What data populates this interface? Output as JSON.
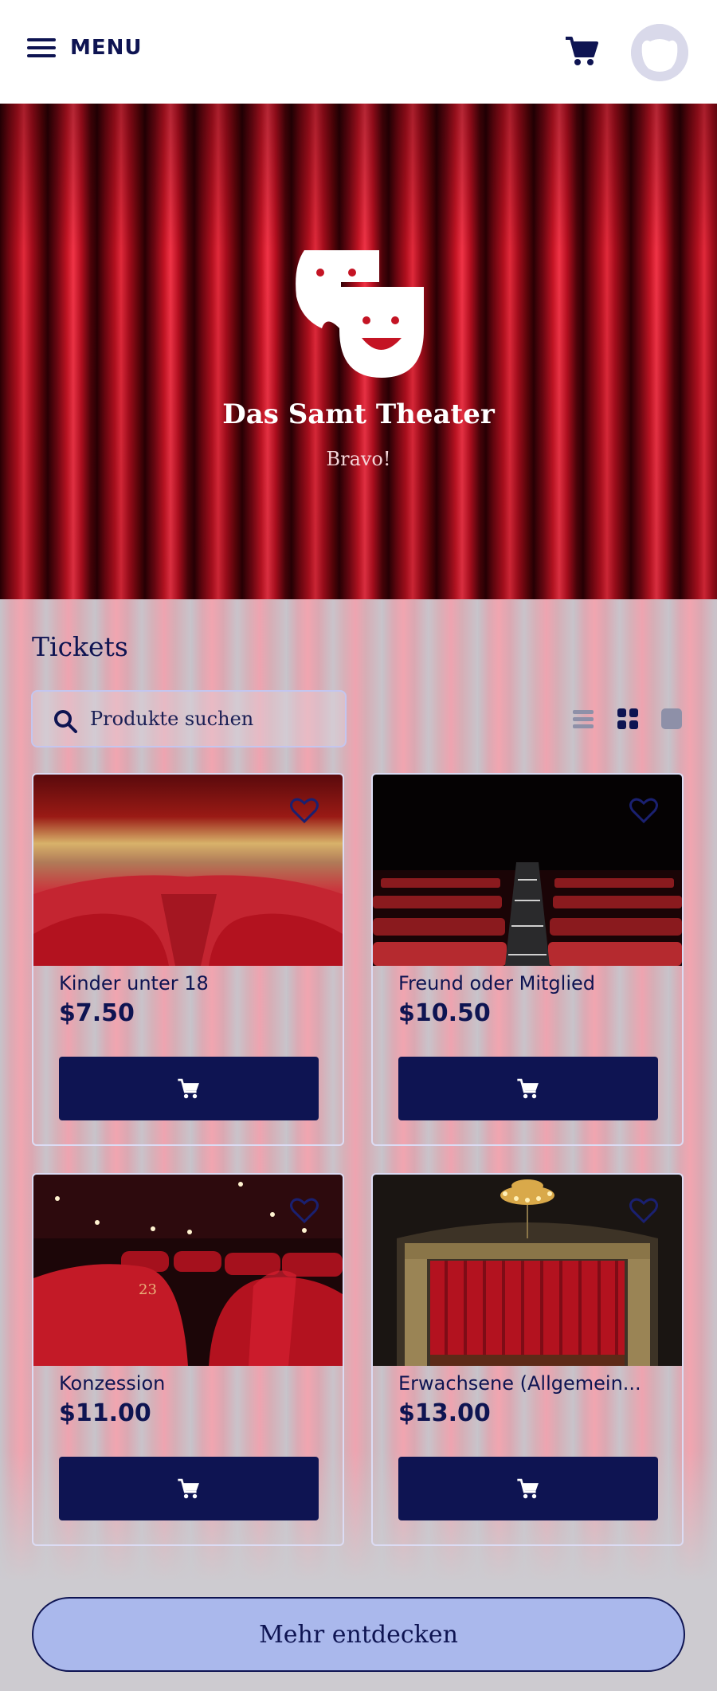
{
  "header": {
    "menu_label": "MENU",
    "cart_icon": "shopping-cart-icon",
    "avatar_icon": "bear-avatar-icon"
  },
  "hero": {
    "title": "Das Samt Theater",
    "subtitle": "Bravo!",
    "logo_icon": "theater-masks-icon"
  },
  "products_section": {
    "title": "Tickets",
    "search_placeholder": "Produkte suchen",
    "view_modes": [
      "list",
      "grid",
      "single"
    ],
    "active_view": "grid",
    "items": [
      {
        "name": "Kinder unter 18",
        "price": "$7.50",
        "image": "blurred-red-theater-seats"
      },
      {
        "name": "Freund oder Mitglied",
        "price": "$10.50",
        "image": "dark-auditorium-aisle"
      },
      {
        "name": "Konzession",
        "price": "$11.00",
        "image": "red-velvet-seat-number-23"
      },
      {
        "name": "Erwachsene (Allgemein...",
        "price": "$13.00",
        "image": "ornate-stage-red-curtain-chandelier"
      }
    ]
  },
  "more_button": "Mehr entdecken",
  "colors": {
    "brand_navy": "#0e1452",
    "more_button_bg": "#aab8ec",
    "curtain_red": "#c41424"
  }
}
